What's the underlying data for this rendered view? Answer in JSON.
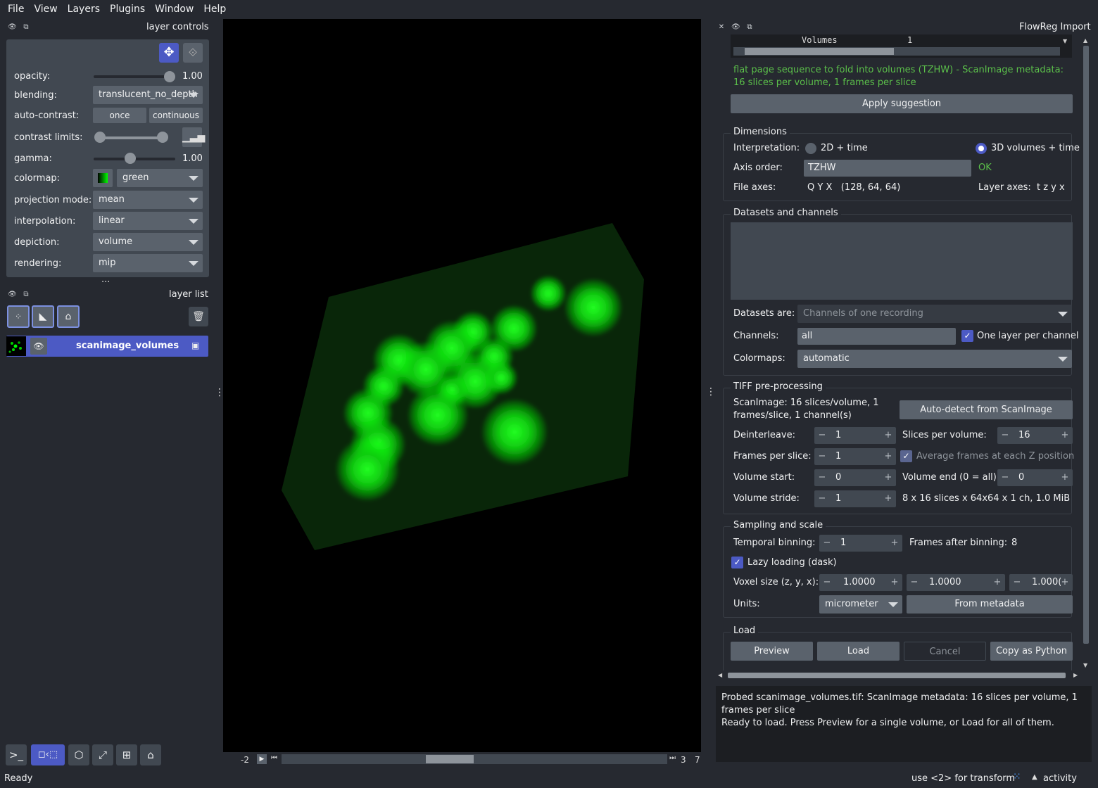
{
  "menu": [
    "File",
    "View",
    "Layers",
    "Plugins",
    "Window",
    "Help"
  ],
  "layer_controls": {
    "title": "layer controls",
    "opacity_label": "opacity:",
    "opacity_value": "1.00",
    "blending_label": "blending:",
    "blending_value": "translucent_no_depth",
    "autocontrast_label": "auto-contrast:",
    "once": "once",
    "continuous": "continuous",
    "contrast_label": "contrast limits:",
    "gamma_label": "gamma:",
    "gamma_value": "1.00",
    "colormap_label": "colormap:",
    "colormap_value": "green",
    "projection_label": "projection mode:",
    "projection_value": "mean",
    "interpolation_label": "interpolation:",
    "interpolation_value": "linear",
    "depiction_label": "depiction:",
    "depiction_value": "volume",
    "rendering_label": "rendering:",
    "rendering_value": "mip",
    "more": "..."
  },
  "layer_list": {
    "title": "layer list",
    "layers": [
      {
        "name": "scanimage_volumes"
      }
    ]
  },
  "dims": {
    "left_value": "-2",
    "right_current": "3",
    "right_total": "7"
  },
  "plugin": {
    "title": "FlowReg Import",
    "top_table_key": "Volumes",
    "top_table_val": "1",
    "suggestion": "flat page sequence to fold into volumes (TZHW) - ScanImage metadata: 16 slices per volume, 1 frames per slice",
    "apply_suggestion": "Apply suggestion",
    "dimensions": {
      "title": "Dimensions",
      "interpretation_label": "Interpretation:",
      "opt_2d": "2D + time",
      "opt_3d": "3D volumes + time",
      "axis_order_label": "Axis order:",
      "axis_order_value": "TZHW",
      "axis_status": "OK",
      "file_axes_label": "File axes:",
      "file_axes_value": "Q Y X   (128, 64, 64)",
      "layer_axes_label": "Layer axes:",
      "layer_axes_value": "t z y x"
    },
    "datasets": {
      "title": "Datasets and channels",
      "are_label": "Datasets are:",
      "are_value": "Channels of one recording",
      "channels_label": "Channels:",
      "channels_value": "all",
      "one_layer": "One layer per channel",
      "colormaps_label": "Colormaps:",
      "colormaps_value": "automatic"
    },
    "tiff": {
      "title": "TIFF pre-processing",
      "info": "ScanImage: 16 slices/volume, 1 frames/slice, 1 channel(s)",
      "autodetect": "Auto-detect from ScanImage",
      "deinterleave_label": "Deinterleave:",
      "deinterleave_value": "1",
      "slices_label": "Slices per volume:",
      "slices_value": "16",
      "frames_label": "Frames per slice:",
      "frames_value": "1",
      "average_label": "Average frames at each Z position",
      "vstart_label": "Volume start:",
      "vstart_value": "0",
      "vend_label": "Volume end (0 = all):",
      "vend_value": "0",
      "vstride_label": "Volume stride:",
      "vstride_value": "1",
      "summary": "8 x 16 slices x 64x64 x 1 ch, 1.0 MiB"
    },
    "sampling": {
      "title": "Sampling and scale",
      "temporal_label": "Temporal binning:",
      "temporal_value": "1",
      "frames_after_label": "Frames after binning:",
      "frames_after_value": "8",
      "lazy_label": "Lazy loading (dask)",
      "voxel_label": "Voxel size (z, y, x):",
      "voxel_z": "1.0000",
      "voxel_y": "1.0000",
      "voxel_x": "1.000(",
      "units_label": "Units:",
      "units_value": "micrometer",
      "from_metadata": "From metadata"
    },
    "load": {
      "title": "Load",
      "preview": "Preview",
      "load": "Load",
      "cancel": "Cancel",
      "copy": "Copy as Python"
    },
    "status": "Probed scanimage_volumes.tif: ScanImage metadata: 16 slices per volume, 1 frames per slice\nReady to load. Press Preview for a single volume, or Load for all of them."
  },
  "statusbar": {
    "left": "Ready",
    "hint": "use <2> for transform",
    "activity": "activity"
  },
  "colors": {
    "accent": "#4c5ac4",
    "ok_green": "#5bbf4a",
    "bg": "#262930",
    "panel": "#414851"
  }
}
